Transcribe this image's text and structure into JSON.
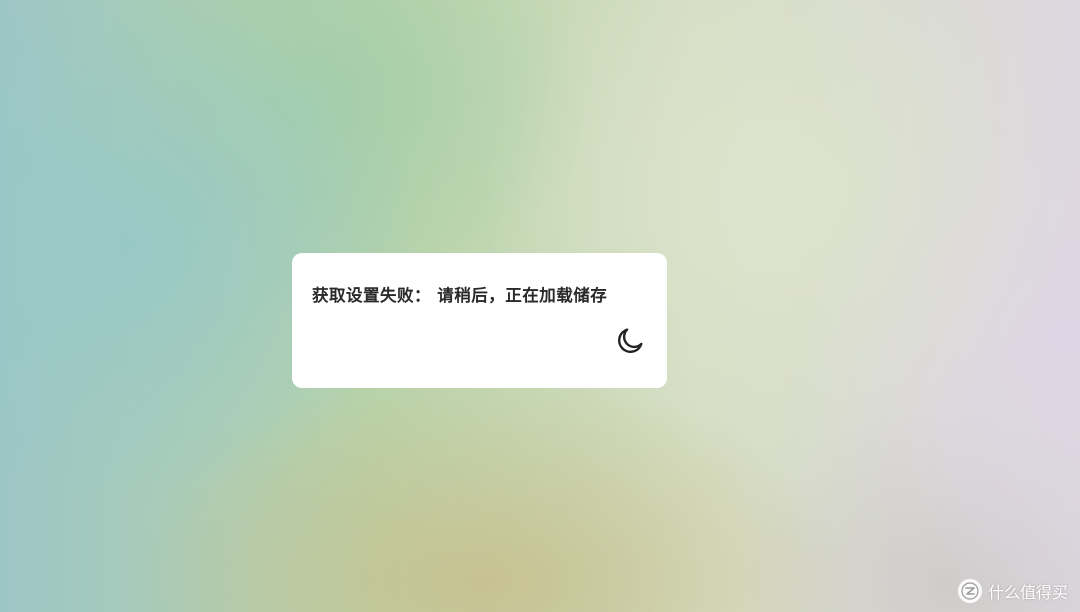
{
  "toast": {
    "message": "获取设置失败： 请稍后，正在加载储存",
    "toggle_icon": "moon-icon"
  },
  "watermark": {
    "logo_icon": "zhi-logo-icon",
    "text": "什么值得买"
  },
  "colors": {
    "card_background": "#ffffff",
    "text": "#2a2a2a",
    "icon": "#222222"
  }
}
